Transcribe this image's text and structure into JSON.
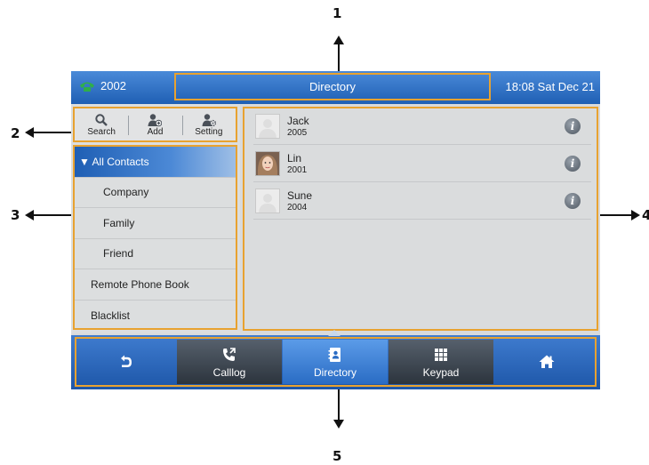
{
  "callouts": [
    "1",
    "2",
    "3",
    "4",
    "5"
  ],
  "status_bar": {
    "line_label": "2002",
    "title": "Directory",
    "clock": "18:08 Sat Dec 21"
  },
  "toolbar": {
    "search_label": "Search",
    "add_label": "Add",
    "setting_label": "Setting"
  },
  "groups": [
    {
      "label": "▼ All Contacts"
    },
    {
      "label": "Company"
    },
    {
      "label": "Family"
    },
    {
      "label": "Friend"
    },
    {
      "label": "Remote Phone Book"
    },
    {
      "label": "Blacklist"
    }
  ],
  "contacts": [
    {
      "name": "Jack",
      "number": "2005",
      "info_icon": "i"
    },
    {
      "name": "Lin",
      "number": "2001",
      "info_icon": "i"
    },
    {
      "name": "Sune",
      "number": "2004",
      "info_icon": "i"
    }
  ],
  "softkeys": {
    "calllog_label": "Calllog",
    "directory_label": "Directory",
    "keypad_label": "Keypad"
  },
  "colors": {
    "accent_orange": "#e8a230",
    "bar_blue": "#1f5fb4",
    "line_icon_green": "#2fae4a"
  }
}
